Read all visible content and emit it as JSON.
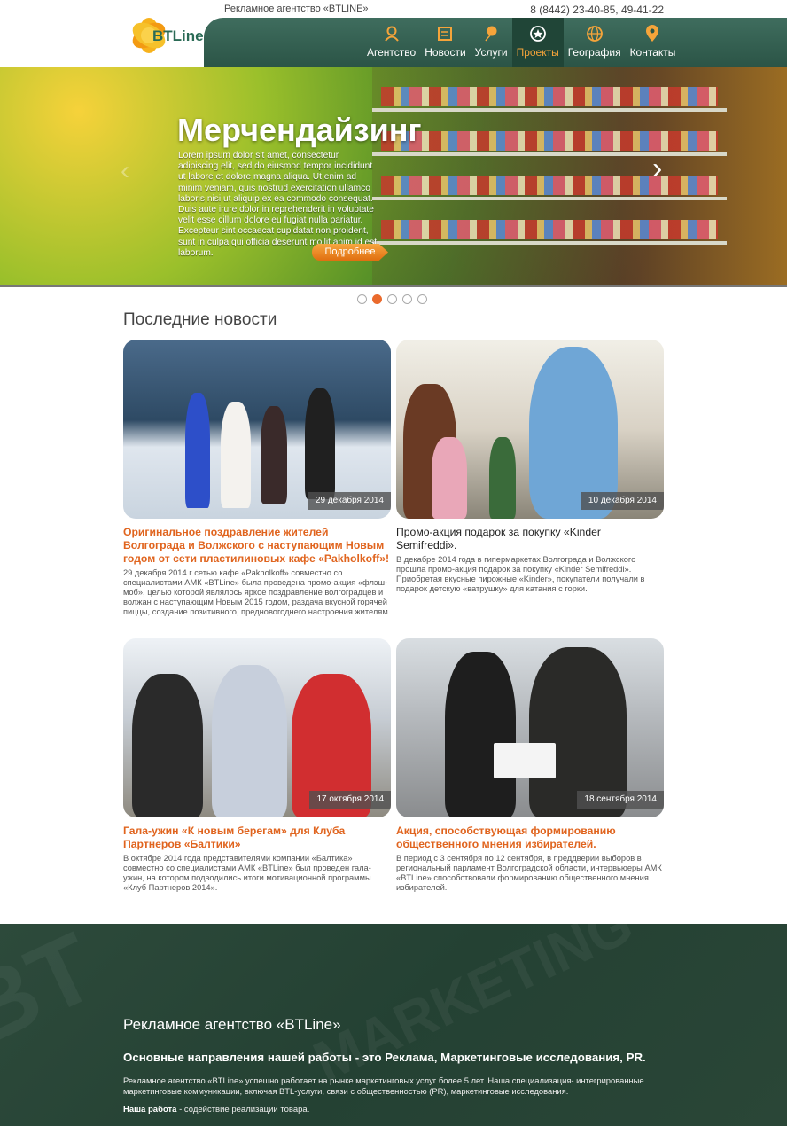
{
  "header": {
    "agency": "Рекламное агентство «BTLINE»",
    "phone": "8 (8442) 23-40-85, 49-41-22",
    "logo_text": "BTLine"
  },
  "nav": {
    "items": [
      {
        "label": "Агентство",
        "icon": "people-icon"
      },
      {
        "label": "Новости",
        "icon": "newspaper-icon"
      },
      {
        "label": "Услуги",
        "icon": "balloon-icon"
      },
      {
        "label": "Проекты",
        "icon": "star-icon",
        "active": true
      },
      {
        "label": "География",
        "icon": "globe-icon"
      },
      {
        "label": "Контакты",
        "icon": "map-pin-icon"
      }
    ]
  },
  "hero": {
    "title": "Мерчендайзинг",
    "text": "Lorem ipsum dolor sit amet, consectetur adipiscing elit, sed do eiusmod tempor incididunt ut labore et dolore magna aliqua. Ut enim ad minim veniam, quis nostrud exercitation ullamco laboris nisi ut aliquip ex ea commodo consequat. Duis aute irure dolor in reprehenderit in voluptate velit esse cillum dolore eu fugiat nulla pariatur. Excepteur sint occaecat cupidatat non proident, sunt in culpa qui officia deserunt mollit anim id est laborum.",
    "button": "Подробнее",
    "prev_icon": "‹",
    "next_icon": "›",
    "slides": 5,
    "active_slide": 2
  },
  "news": {
    "title": "Последние новости",
    "items": [
      {
        "date": "29 декабря 2014",
        "title": "Оригинальное поздравление жителей Волгограда и Волжского с наступающим Новым годом от сети пластилиновых кафе «Pakholkoff»!",
        "text": "29 декабря 2014 г сетью кафе «Pakholkoff» совместно со специалистами АМК «BTLine» была проведена промо-акция «флэш-моб», целью которой являлось яркое поздравление волгоградцев и волжан с наступающим Новым 2015 годом, раздача вкусной горячей пиццы, создание позитивного, предновогоднего настроения жителям."
      },
      {
        "date": "10 декабря 2014",
        "title": "Промо-акция подарок за покупку «Kinder Semifreddi».",
        "text": "В декабре 2014 года в гипермаркетах Волгограда и Волжского прошла промо-акция подарок за покупку «Kinder Semifreddi». Приобретая вкусные пирожные «Kinder», покупатели получали в подарок детскую «ватрушку» для катания с горки."
      },
      {
        "date": "17 октября 2014",
        "title": "Гала-ужин «К новым берегам» для Клуба Партнеров «Балтики»",
        "text": "В октябре 2014 года представителями компании «Балтика» совместно со специалистами АМК «BTLine» был проведен гала-ужин, на котором подводились итоги мотивационной программы «Клуб Партнеров 2014»."
      },
      {
        "date": "18 сентября 2014",
        "title": "Акция, способствующая формированию общественного мнения избирателей.",
        "text": "В период с 3 сентября по 12 сентября, в преддверии выборов в региональный парламент Волгоградской области, интервьюеры АМК «BTLine» способствовали формированию общественного мнения избирателей."
      }
    ]
  },
  "footer": {
    "title": "Рекламное агентство «BTLine»",
    "subtitle": "Основные направления нашей работы - это Реклама, Маркетинговые исследования, PR.",
    "text": "Рекламное агентство «BTLine» успешно работает на рынке маркетинговых услуг более 5 лет. Наша специализация- интегрированные маркетинговые коммуникации, включая BTL-услуги, связи с общественностью (PR), маркетинговые исследования.",
    "work_label": "Наша работа",
    "work_text": " - содействие реализации товара.",
    "watermark": "MARKETING"
  },
  "colors": {
    "accent": "#e0641e",
    "nav_bg": "#2b5446",
    "footer_bg": "#244133"
  }
}
